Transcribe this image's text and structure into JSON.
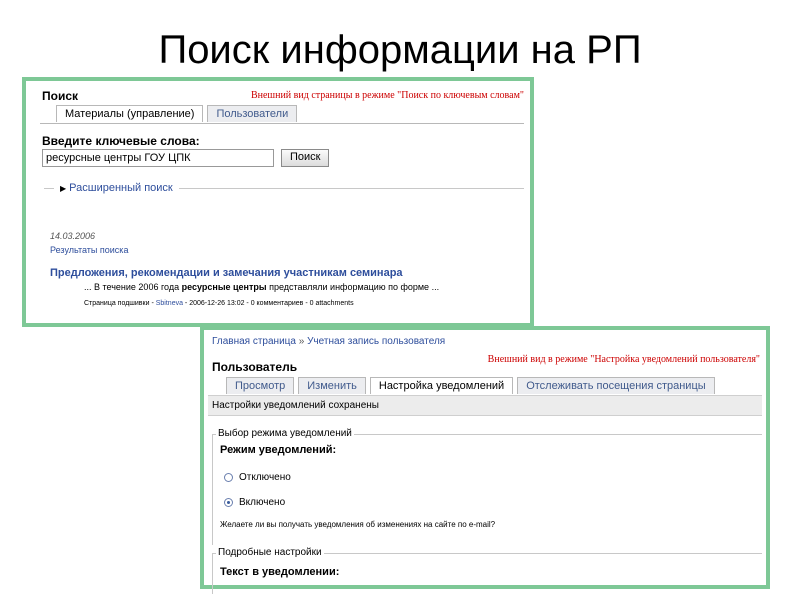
{
  "slide_title": "Поиск информации на РП",
  "search_panel": {
    "heading": "Поиск",
    "note": "Внешний вид страницы в режиме \"Поиск по ключевым словам\"",
    "tabs": [
      "Материалы (управление)",
      "Пользователи"
    ],
    "active_tab": "Материалы (управление)",
    "keywords_label": "Введите ключевые слова:",
    "query_value": "ресурсные центры ГОУ ЦПК",
    "search_button": "Поиск",
    "advanced_link": "Расширенный поиск",
    "date": "14.03.2006",
    "results_link": "Результаты поиска",
    "result": {
      "title": "Предложения, рекомендации и замечания участникам семинара",
      "snippet_prefix": "... В течение 2006 года ",
      "snippet_bold": "ресурсные центры",
      "snippet_suffix": " представляли информацию по форме ...",
      "meta_prefix": "Страница подшивки - ",
      "meta_user": "Sbitneva",
      "meta_suffix": " - 2006-12-26 13:02 - 0 комментариев - 0 attachments"
    }
  },
  "notify_panel": {
    "breadcrumb_home": "Главная страница",
    "breadcrumb_sep": "»",
    "breadcrumb_account": "Учетная запись пользователя",
    "heading": "Пользователь",
    "note": "Внешний вид в режиме \"Настройка уведомлений пользователя\"",
    "tabs": [
      "Просмотр",
      "Изменить",
      "Настройка уведомлений",
      "Отслеживать посещения страницы"
    ],
    "active_tab": "Настройка уведомлений",
    "saved_message": "Настройки уведомлений сохранены",
    "mode_legend": "Выбор режима уведомлений",
    "mode_label": "Режим уведомлений:",
    "options": [
      "Отключено",
      "Включено"
    ],
    "selected_option": "Включено",
    "email_question": "Желаете ли вы получать уведомления об изменениях на сайте по e-mail?",
    "details_legend": "Подробные настройки",
    "text_label": "Текст в уведомлении:"
  },
  "colors": {
    "panel_border": "#7ec896",
    "link": "#2e4e9c",
    "note_red": "#cc0000"
  }
}
